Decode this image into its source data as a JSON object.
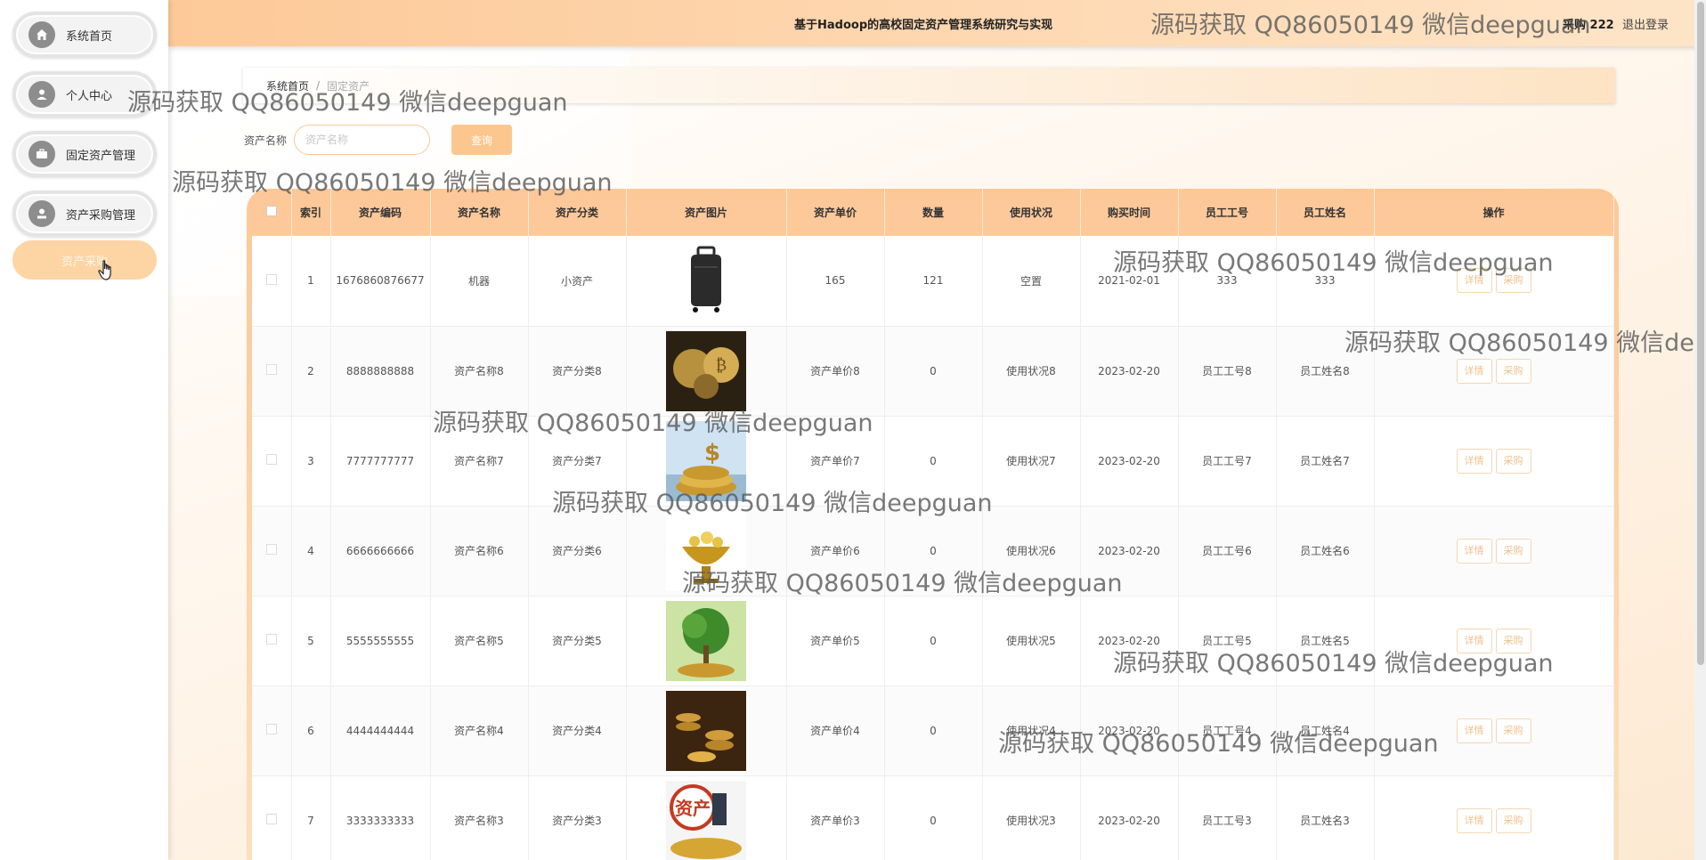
{
  "sidebar": {
    "items": [
      {
        "label": "系统首页",
        "icon": "home-icon"
      },
      {
        "label": "个人中心",
        "icon": "user-icon"
      },
      {
        "label": "固定资产管理",
        "icon": "briefcase-icon"
      },
      {
        "label": "资产采购管理",
        "icon": "purchase-icon"
      },
      {
        "label": "资产采购",
        "icon": ""
      }
    ]
  },
  "header": {
    "title": "基于Hadoop的高校固定资产管理系统研究与实现",
    "user": "采购 222",
    "logout": "退出登录"
  },
  "breadcrumb": {
    "home": "系统首页",
    "separator": "/",
    "current": "固定资产"
  },
  "search": {
    "label": "资产名称",
    "placeholder": "资产名称",
    "button": "查询"
  },
  "table": {
    "columns": [
      "索引",
      "资产编码",
      "资产名称",
      "资产分类",
      "资产图片",
      "资产单价",
      "数量",
      "使用状况",
      "购买时间",
      "员工工号",
      "员工姓名",
      "操作"
    ],
    "rows": [
      {
        "idx": "1",
        "code": "1676860876677",
        "name": "机器",
        "category": "小资产",
        "price": "165",
        "qty": "121",
        "status": "空置",
        "date": "2021-02-01",
        "emp_no": "333",
        "emp_name": "333"
      },
      {
        "idx": "2",
        "code": "8888888888",
        "name": "资产名称8",
        "category": "资产分类8",
        "price": "资产单价8",
        "qty": "0",
        "status": "使用状况8",
        "date": "2023-02-20",
        "emp_no": "员工工号8",
        "emp_name": "员工姓名8"
      },
      {
        "idx": "3",
        "code": "7777777777",
        "name": "资产名称7",
        "category": "资产分类7",
        "price": "资产单价7",
        "qty": "0",
        "status": "使用状况7",
        "date": "2023-02-20",
        "emp_no": "员工工号7",
        "emp_name": "员工姓名7"
      },
      {
        "idx": "4",
        "code": "6666666666",
        "name": "资产名称6",
        "category": "资产分类6",
        "price": "资产单价6",
        "qty": "0",
        "status": "使用状况6",
        "date": "2023-02-20",
        "emp_no": "员工工号6",
        "emp_name": "员工姓名6"
      },
      {
        "idx": "5",
        "code": "5555555555",
        "name": "资产名称5",
        "category": "资产分类5",
        "price": "资产单价5",
        "qty": "0",
        "status": "使用状况5",
        "date": "2023-02-20",
        "emp_no": "员工工号5",
        "emp_name": "员工姓名5"
      },
      {
        "idx": "6",
        "code": "4444444444",
        "name": "资产名称4",
        "category": "资产分类4",
        "price": "资产单价4",
        "qty": "0",
        "status": "使用状况4",
        "date": "2023-02-20",
        "emp_no": "员工工号4",
        "emp_name": "员工姓名4"
      },
      {
        "idx": "7",
        "code": "3333333333",
        "name": "资产名称3",
        "category": "资产分类3",
        "price": "资产单价3",
        "qty": "0",
        "status": "使用状况3",
        "date": "2023-02-20",
        "emp_no": "员工工号3",
        "emp_name": "员工姓名3"
      }
    ],
    "actions": {
      "detail": "详情",
      "purchase": "采购"
    },
    "image_badge_text": "资产"
  },
  "watermark": {
    "text": "源码获取 QQ86050149 微信deepguan"
  },
  "colors": {
    "accent": "#fdc998",
    "accent_light": "#fee5c8",
    "button": "#fcc78f",
    "active_menu": "#fdd4a3"
  }
}
